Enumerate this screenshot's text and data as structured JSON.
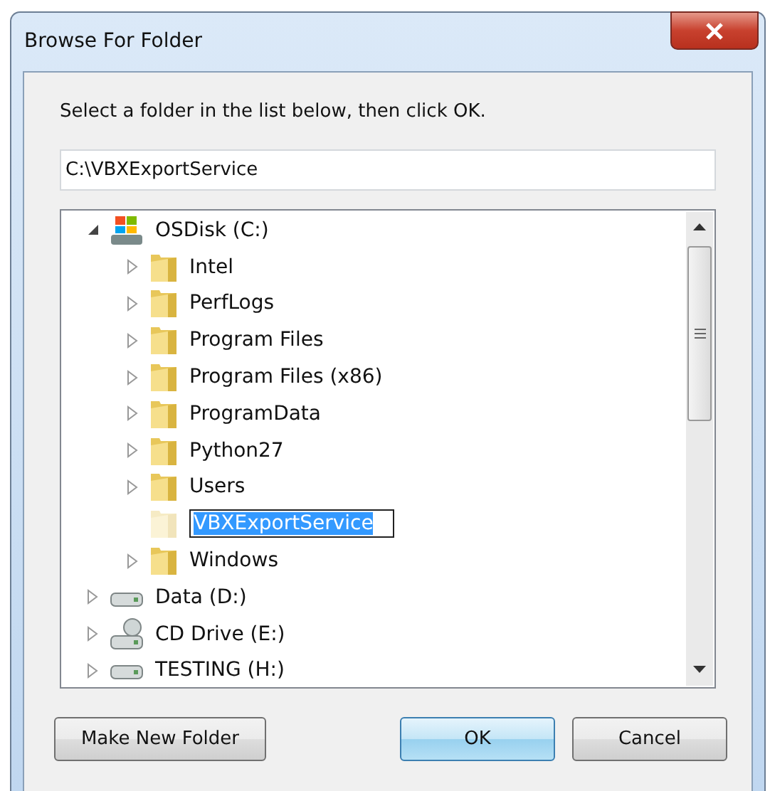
{
  "window": {
    "title": "Browse For Folder"
  },
  "instruction": "Select a folder in the list below, then click OK.",
  "path_field": {
    "value": "C:\\VBXExportService"
  },
  "tree": [
    {
      "label": "OSDisk (C:)",
      "kind": "system-drive",
      "expanded": true,
      "selected": false,
      "children": [
        {
          "label": "Intel",
          "kind": "folder",
          "expanded": false,
          "selected": false
        },
        {
          "label": "PerfLogs",
          "kind": "folder",
          "expanded": false,
          "selected": false
        },
        {
          "label": "Program Files",
          "kind": "folder",
          "expanded": false,
          "selected": false
        },
        {
          "label": "Program Files (x86)",
          "kind": "folder",
          "expanded": false,
          "selected": false
        },
        {
          "label": "ProgramData",
          "kind": "folder",
          "expanded": false,
          "selected": false
        },
        {
          "label": "Python27",
          "kind": "folder",
          "expanded": false,
          "selected": false
        },
        {
          "label": "Users",
          "kind": "folder",
          "expanded": false,
          "selected": false
        },
        {
          "label": "VBXExportService",
          "kind": "folder",
          "selected": true
        },
        {
          "label": "Windows",
          "kind": "folder",
          "expanded": false,
          "selected": false
        }
      ]
    },
    {
      "label": "Data (D:)",
      "kind": "drive",
      "expanded": false,
      "selected": false
    },
    {
      "label": "CD Drive (E:)",
      "kind": "network-drive",
      "expanded": false,
      "selected": false
    },
    {
      "label": "TESTING (H:)",
      "kind": "drive",
      "expanded": false,
      "selected": false
    }
  ],
  "buttons": [
    {
      "label": "Make New Folder",
      "kind": "secondary"
    },
    {
      "label": "OK",
      "kind": "default"
    },
    {
      "label": "Cancel",
      "kind": "secondary"
    }
  ]
}
